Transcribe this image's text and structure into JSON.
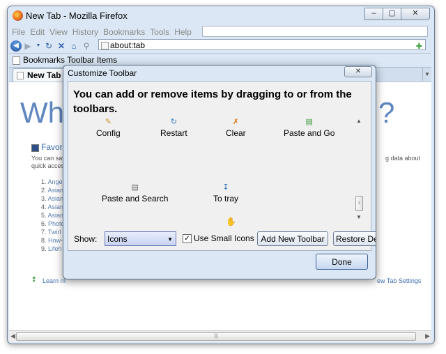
{
  "window": {
    "title": "New Tab - Mozilla Firefox",
    "controls": [
      "–",
      "▢",
      "✕"
    ]
  },
  "menu": [
    "File",
    "Edit",
    "View",
    "History",
    "Bookmarks",
    "Tools",
    "Help"
  ],
  "nav": {
    "url": "about:tab"
  },
  "bookmarks_bar": {
    "label": "Bookmarks Toolbar Items"
  },
  "tab": {
    "label": "New Tab"
  },
  "background_page": {
    "heading_left": "Wha",
    "heading_right": "?",
    "favorites": "Favorit",
    "desc_line1": "You can sav",
    "desc_line2": "quick acces",
    "desc_right": "g data about",
    "list": [
      {
        "n": "1.",
        "t": "Angel"
      },
      {
        "n": "2.",
        "t": "Asian"
      },
      {
        "n": "3.",
        "t": "Asian"
      },
      {
        "n": "4.",
        "t": "Asian"
      },
      {
        "n": "5.",
        "t": "Asian"
      },
      {
        "n": "6.",
        "t": "Photo"
      },
      {
        "n": "7.",
        "t": "Twirl"
      },
      {
        "n": "8.",
        "t": "How-"
      },
      {
        "n": "9.",
        "t": "Lifeh"
      }
    ],
    "learn_more": "Learn m",
    "settings": "ew Tab Settings"
  },
  "dialog": {
    "title": "Customize Toolbar",
    "close": "✕",
    "instructions": "You can add or remove items by dragging to or from the toolbars.",
    "palette": [
      {
        "label": "Config",
        "icon": "config-icon",
        "glyph": "✎",
        "color": "#c8912d"
      },
      {
        "label": "Restart",
        "icon": "restart-icon",
        "glyph": "↻",
        "color": "#2f79c8"
      },
      {
        "label": "Clear",
        "icon": "clear-icon",
        "glyph": "✗",
        "color": "#d77b1e"
      },
      {
        "label": "Paste and Go",
        "icon": "paste-and-go-icon",
        "glyph": "▤",
        "color": "#3f9a3f"
      },
      {
        "label": "Paste and Search",
        "icon": "paste-and-search-icon",
        "glyph": "▤",
        "color": "#6c6c6c"
      },
      {
        "label": "To tray",
        "icon": "to-tray-icon",
        "glyph": "↧",
        "color": "#2d6fb5"
      }
    ],
    "show_label": "Show:",
    "show_value": "Icons",
    "small_icons_label": "Use Small Icons",
    "small_icons_checked": true,
    "add_toolbar": "Add New Toolbar",
    "restore": "Restore De",
    "done": "Done"
  }
}
